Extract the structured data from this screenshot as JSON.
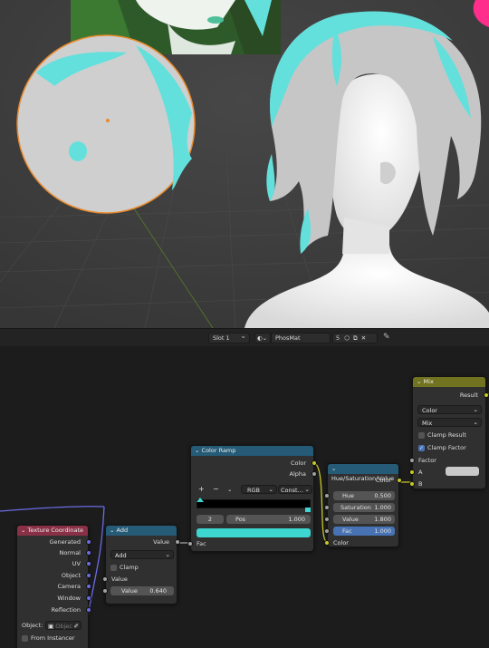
{
  "header": {
    "slot": "Slot 1",
    "material": "PhosMat",
    "users": "5"
  },
  "nodes": {
    "texcoord": {
      "title": "Texture Coordinate",
      "outputs": [
        "Generated",
        "Normal",
        "UV",
        "Object",
        "Camera",
        "Window",
        "Reflection"
      ],
      "object_label": "Object:",
      "object_placeholder": "Objec",
      "from_instancer": "From Instancer"
    },
    "add": {
      "title": "Add",
      "output": "Value",
      "operation": "Add",
      "clamp": "Clamp",
      "input_value": "Value",
      "value_label": "Value",
      "value": "0.640"
    },
    "colorramp": {
      "title": "Color Ramp",
      "out_color": "Color",
      "out_alpha": "Alpha",
      "mode": "RGB",
      "interp": "Const...",
      "index": "2",
      "pos_label": "Pos",
      "pos": "1.000",
      "input": "Fac",
      "ramp_color": "#3ed6d0"
    },
    "hsv": {
      "title": "Hue/Saturation/Value",
      "output": "Color",
      "hue_label": "Hue",
      "hue": "0.500",
      "sat_label": "Saturation",
      "sat": "1.000",
      "val_label": "Value",
      "val": "1.800",
      "fac_label": "Fac",
      "fac": "1.000",
      "input": "Color"
    },
    "mix": {
      "title": "Mix",
      "output": "Result",
      "data_type": "Color",
      "blend": "Mix",
      "clamp_result": "Clamp Result",
      "clamp_factor": "Clamp Factor",
      "factor": "Factor",
      "a": "A",
      "b": "B"
    }
  },
  "colors": {
    "hair_cyan": "#63e0dc",
    "wire_purple": "#6c6ce8",
    "wire_gray": "#a1a1a1",
    "wire_yellow": "#c7c729",
    "selection_orange": "#e88a2d"
  }
}
